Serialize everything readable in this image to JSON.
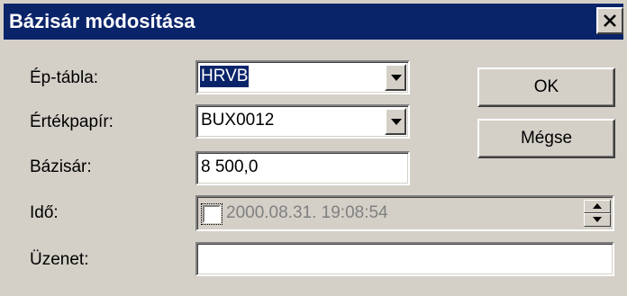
{
  "window": {
    "title": "Bázisár módosítása",
    "close_glyph": "✕"
  },
  "form": {
    "ep_tabla": {
      "label": "Ép-tábla:",
      "value": "HRVB"
    },
    "ertekpapir": {
      "label": "Értékpapír:",
      "value": "BUX0012"
    },
    "bazisar": {
      "label": "Bázisár:",
      "value": "8 500,0"
    },
    "ido": {
      "label": "Idő:",
      "value": "2000.08.31. 19:08:54",
      "checked": false,
      "enabled": false
    },
    "uzenet": {
      "label": "Üzenet:",
      "value": ""
    }
  },
  "buttons": {
    "ok": "OK",
    "cancel": "Mégse"
  },
  "colors": {
    "title_bar": "#0a246a",
    "dialog_face": "#d4d0c8",
    "selection": "#0a246a"
  }
}
